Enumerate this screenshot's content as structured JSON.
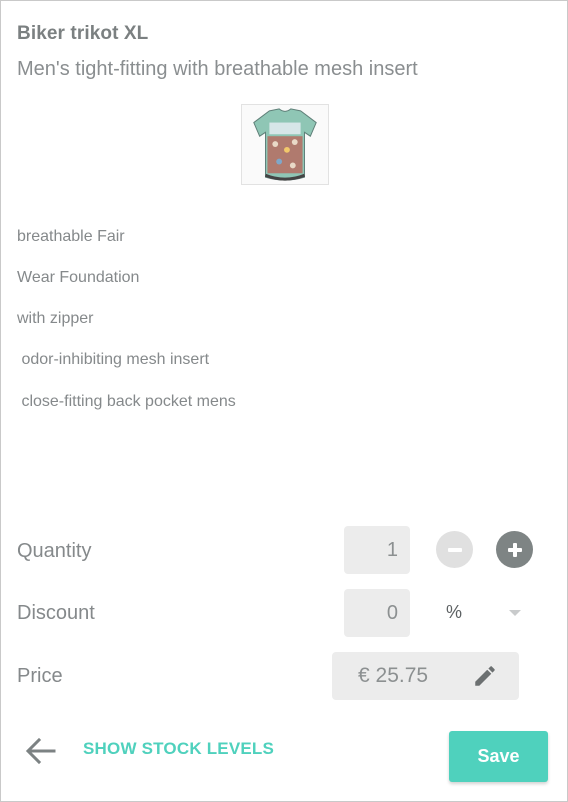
{
  "product": {
    "title": "Biker trikot XL",
    "subtitle": "Men's tight-fitting with breathable mesh insert",
    "image_icon": "jersey-image",
    "description": [
      "breathable Fair",
      "Wear Foundation",
      "with zipper",
      " odor-inhibiting mesh insert",
      " close-fitting back pocket mens"
    ]
  },
  "quantity": {
    "label": "Quantity",
    "value": "1",
    "decrement_icon": "minus-icon",
    "increment_icon": "plus-icon"
  },
  "discount": {
    "label": "Discount",
    "value": "0",
    "unit": "%",
    "unit_dropdown_icon": "caret-down-icon"
  },
  "price": {
    "label": "Price",
    "value": "€ 25.75",
    "edit_icon": "pencil-icon"
  },
  "footer": {
    "back_icon": "arrow-left-icon",
    "stock_link": "SHOW STOCK LEVELS",
    "save_label": "Save"
  },
  "colors": {
    "accent": "#4fd1bd",
    "text": "#85898b",
    "field_bg": "#ececec"
  }
}
